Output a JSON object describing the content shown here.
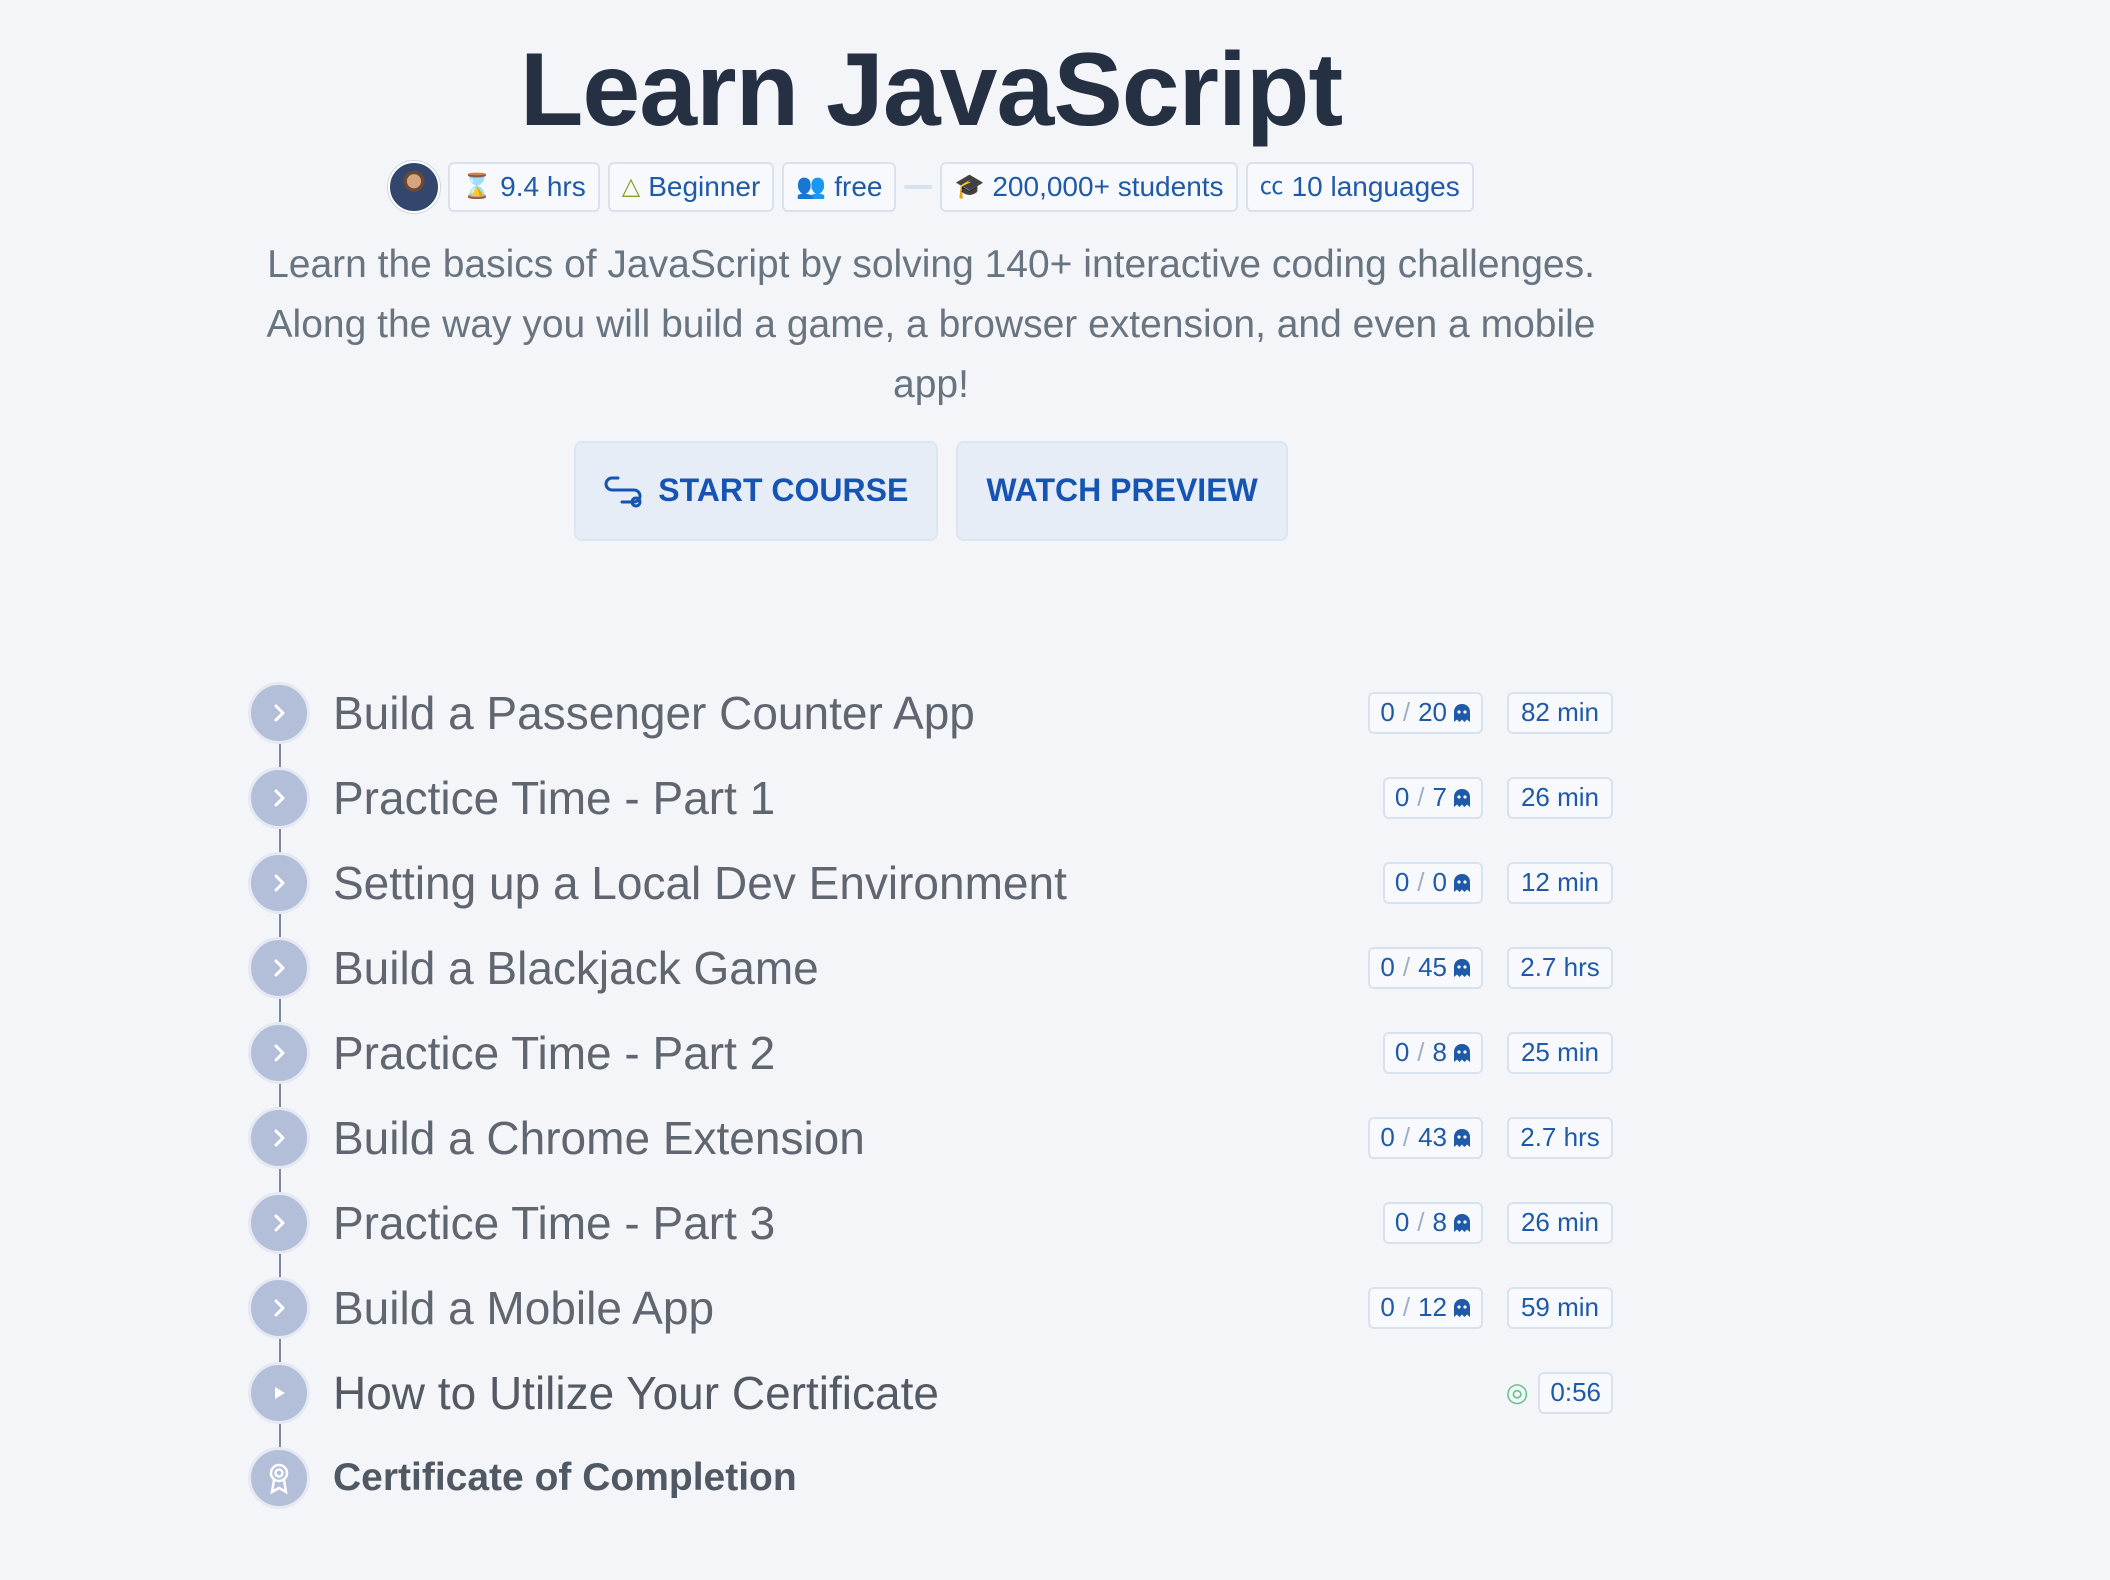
{
  "title": "Learn JavaScript",
  "meta": {
    "duration": "9.4 hrs",
    "level": "Beginner",
    "price": "free",
    "students": "200,000+ students",
    "languages": "10 languages"
  },
  "description": "Learn the basics of JavaScript by solving 140+ interactive coding challenges. Along the way you will build a game, a browser extension, and even a mobile app!",
  "actions": {
    "start": "START COURSE",
    "preview": "WATCH PREVIEW"
  },
  "modules": [
    {
      "title": "Build a Passenger Counter App",
      "done": "0",
      "total": "20",
      "time": "82 min"
    },
    {
      "title": "Practice Time - Part 1",
      "done": "0",
      "total": "7",
      "time": "26 min"
    },
    {
      "title": "Setting up a Local Dev Environment",
      "done": "0",
      "total": "0",
      "time": "12 min"
    },
    {
      "title": "Build a Blackjack Game",
      "done": "0",
      "total": "45",
      "time": "2.7 hrs"
    },
    {
      "title": "Practice Time - Part 2",
      "done": "0",
      "total": "8",
      "time": "25 min"
    },
    {
      "title": "Build a Chrome Extension",
      "done": "0",
      "total": "43",
      "time": "2.7 hrs"
    },
    {
      "title": "Practice Time - Part 3",
      "done": "0",
      "total": "8",
      "time": "26 min"
    },
    {
      "title": "Build a Mobile App",
      "done": "0",
      "total": "12",
      "time": "59 min"
    }
  ],
  "certificate_lesson": {
    "title": "How to Utilize Your Certificate",
    "time": "0:56"
  },
  "certificate": {
    "title": "Certificate of Completion"
  },
  "icons": {
    "duration": "hourglass-icon",
    "level": "triangle-icon",
    "price": "people-icon",
    "students": "graduation-cap-icon",
    "languages": "closed-captions-icon",
    "module": "chevron-right-icon",
    "lesson": "play-icon",
    "certificate": "award-icon",
    "challenge": "ghost-icon",
    "fingerprint": "fingerprint-icon"
  },
  "colors": {
    "accent": "#1654b3",
    "circle": "#b3bfd8",
    "title": "#253143"
  }
}
